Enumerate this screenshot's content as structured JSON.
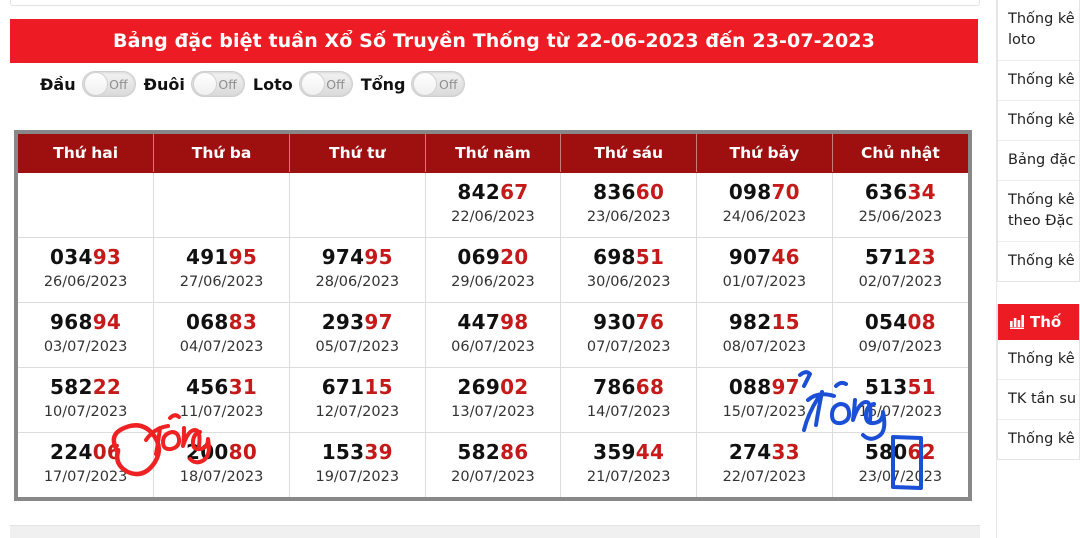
{
  "banner": {
    "title": "Bảng đặc biệt tuần Xổ Số Truyền Thống từ 22-06-2023 đến 23-07-2023",
    "background_color": "#ed1c24"
  },
  "filters": {
    "items": [
      {
        "label": "Đầu",
        "state": "Off"
      },
      {
        "label": "Đuôi",
        "state": "Off"
      },
      {
        "label": "Loto",
        "state": "Off"
      },
      {
        "label": "Tổng",
        "state": "Off"
      }
    ]
  },
  "table": {
    "header_color": "#9e1010",
    "weekend_color": "#ddeedd",
    "tail_color": "#c41a1a",
    "columns": [
      "Thứ hai",
      "Thứ ba",
      "Thứ tư",
      "Thứ năm",
      "Thứ sáu",
      "Thứ bảy",
      "Chủ nhật"
    ],
    "rows": [
      [
        {
          "head": "",
          "tail": "",
          "date": ""
        },
        {
          "head": "",
          "tail": "",
          "date": ""
        },
        {
          "head": "",
          "tail": "",
          "date": ""
        },
        {
          "head": "842",
          "tail": "67",
          "date": "22/06/2023"
        },
        {
          "head": "836",
          "tail": "60",
          "date": "23/06/2023"
        },
        {
          "head": "098",
          "tail": "70",
          "date": "24/06/2023"
        },
        {
          "head": "636",
          "tail": "34",
          "date": "25/06/2023"
        }
      ],
      [
        {
          "head": "034",
          "tail": "93",
          "date": "26/06/2023"
        },
        {
          "head": "491",
          "tail": "95",
          "date": "27/06/2023"
        },
        {
          "head": "974",
          "tail": "95",
          "date": "28/06/2023"
        },
        {
          "head": "069",
          "tail": "20",
          "date": "29/06/2023"
        },
        {
          "head": "698",
          "tail": "51",
          "date": "30/06/2023"
        },
        {
          "head": "907",
          "tail": "46",
          "date": "01/07/2023"
        },
        {
          "head": "571",
          "tail": "23",
          "date": "02/07/2023"
        }
      ],
      [
        {
          "head": "968",
          "tail": "94",
          "date": "03/07/2023"
        },
        {
          "head": "068",
          "tail": "83",
          "date": "04/07/2023"
        },
        {
          "head": "293",
          "tail": "97",
          "date": "05/07/2023"
        },
        {
          "head": "447",
          "tail": "98",
          "date": "06/07/2023"
        },
        {
          "head": "930",
          "tail": "76",
          "date": "07/07/2023"
        },
        {
          "head": "982",
          "tail": "15",
          "date": "08/07/2023"
        },
        {
          "head": "054",
          "tail": "08",
          "date": "09/07/2023"
        }
      ],
      [
        {
          "head": "582",
          "tail": "22",
          "date": "10/07/2023"
        },
        {
          "head": "456",
          "tail": "31",
          "date": "11/07/2023"
        },
        {
          "head": "671",
          "tail": "15",
          "date": "12/07/2023"
        },
        {
          "head": "269",
          "tail": "02",
          "date": "13/07/2023"
        },
        {
          "head": "786",
          "tail": "68",
          "date": "14/07/2023"
        },
        {
          "head": "088",
          "tail": "97",
          "date": "15/07/2023"
        },
        {
          "head": "513",
          "tail": "51",
          "date": "16/07/2023"
        }
      ],
      [
        {
          "head": "224",
          "tail": "06",
          "date": "17/07/2023"
        },
        {
          "head": "200",
          "tail": "80",
          "date": "18/07/2023"
        },
        {
          "head": "153",
          "tail": "39",
          "date": "19/07/2023"
        },
        {
          "head": "582",
          "tail": "86",
          "date": "20/07/2023"
        },
        {
          "head": "359",
          "tail": "44",
          "date": "21/07/2023"
        },
        {
          "head": "274",
          "tail": "33",
          "date": "22/07/2023"
        },
        {
          "head": "580",
          "tail": "62",
          "date": "23/07/2023"
        }
      ]
    ]
  },
  "annotations": {
    "red_text": "Tổng",
    "red_color": "#ee2222",
    "blue_text": "Tổng",
    "blue_color": "#1a4fd6",
    "red_circled_digit": "6",
    "blue_boxed_digit": "0"
  },
  "sidebar": {
    "list_a": [
      {
        "label": "Thống kê",
        "label2": "loto"
      },
      {
        "label": "Thống kê"
      },
      {
        "label": "Thống kê"
      },
      {
        "label": "Bảng đặc"
      },
      {
        "label": "Thống kê",
        "label2": "theo Đặc"
      },
      {
        "label": "Thống kê"
      }
    ],
    "block_b": {
      "header": "Thố",
      "header_icon": "bar-chart-icon",
      "header_color": "#ed1c24",
      "items": [
        {
          "label": "Thống kê"
        },
        {
          "label": "TK tần su"
        },
        {
          "label": "Thống kê"
        }
      ]
    }
  }
}
